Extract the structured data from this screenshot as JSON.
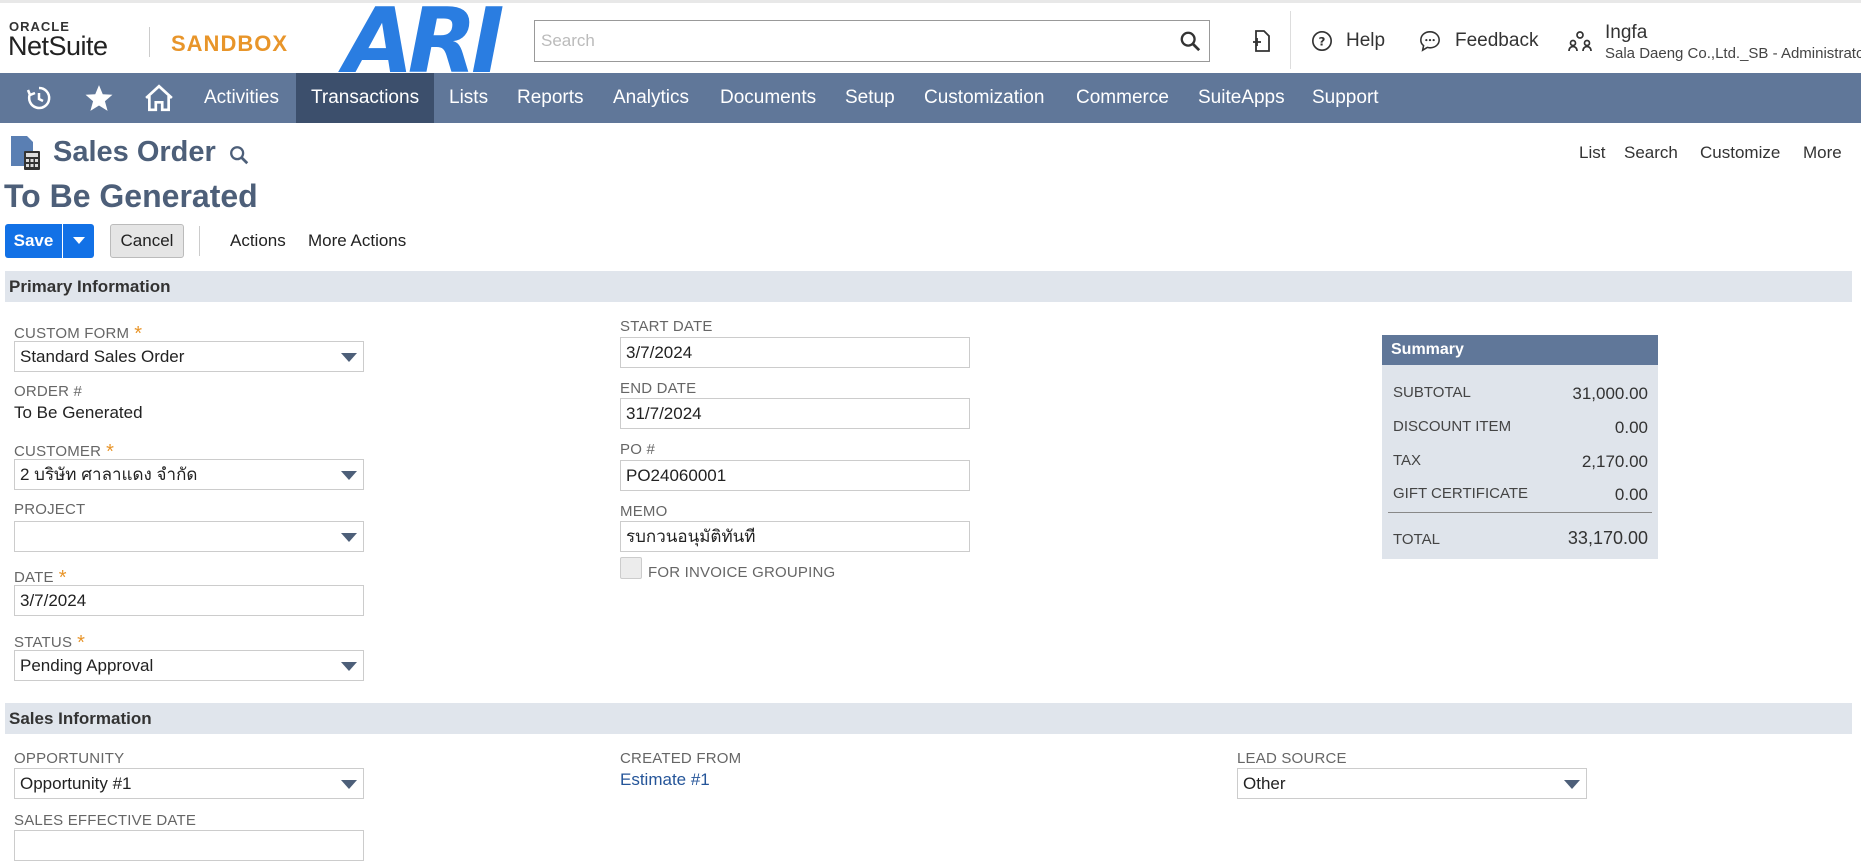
{
  "header": {
    "oracle": "ORACLE",
    "netsuite": "NetSuite",
    "sandbox": "SANDBOX",
    "ari": "ARI",
    "search_placeholder": "Search",
    "help": "Help",
    "feedback": "Feedback",
    "user_name": "Ingfa",
    "user_role": "Sala Daeng Co.,Ltd._SB - Administrator"
  },
  "nav": {
    "items": [
      "Activities",
      "Transactions",
      "Lists",
      "Reports",
      "Analytics",
      "Documents",
      "Setup",
      "Customization",
      "Commerce",
      "SuiteApps",
      "Support"
    ],
    "active": "Transactions"
  },
  "page": {
    "title": "Sales Order",
    "record_title": "To Be Generated",
    "links": [
      "List",
      "Search",
      "Customize",
      "More"
    ]
  },
  "toolbar": {
    "save": "Save",
    "cancel": "Cancel",
    "actions": "Actions",
    "more_actions": "More Actions"
  },
  "primary": {
    "section": "Primary Information",
    "custom_form_label": "CUSTOM FORM",
    "custom_form": "Standard Sales Order",
    "order_label": "ORDER #",
    "order": "To Be Generated",
    "customer_label": "CUSTOMER",
    "customer": "2 บริษัท ศาลาแดง จำกัด",
    "project_label": "PROJECT",
    "project": "",
    "date_label": "DATE",
    "date": "3/7/2024",
    "status_label": "STATUS",
    "status": "Pending Approval",
    "start_date_label": "START DATE",
    "start_date": "3/7/2024",
    "end_date_label": "END DATE",
    "end_date": "31/7/2024",
    "po_label": "PO #",
    "po": "PO24060001",
    "memo_label": "MEMO",
    "memo": "รบกวนอนุมัติทันที",
    "invoice_grouping_label": "FOR INVOICE GROUPING"
  },
  "summary": {
    "title": "Summary",
    "subtotal_label": "SUBTOTAL",
    "subtotal": "31,000.00",
    "discount_label": "DISCOUNT ITEM",
    "discount": "0.00",
    "tax_label": "TAX",
    "tax": "2,170.00",
    "gift_label": "GIFT CERTIFICATE",
    "gift": "0.00",
    "total_label": "TOTAL",
    "total": "33,170.00"
  },
  "sales": {
    "section": "Sales Information",
    "opportunity_label": "OPPORTUNITY",
    "opportunity": "Opportunity #1",
    "sales_effective_date_label": "SALES EFFECTIVE DATE",
    "sales_effective_date": "",
    "created_from_label": "CREATED FROM",
    "created_from": "Estimate #1",
    "lead_source_label": "LEAD SOURCE",
    "lead_source": "Other"
  },
  "colors": {
    "nav_bg": "#607799",
    "nav_active": "#3c4f6c",
    "save_blue": "#1271e6",
    "sandbox_orange": "#e8952a",
    "title_color": "#4d5f79"
  }
}
